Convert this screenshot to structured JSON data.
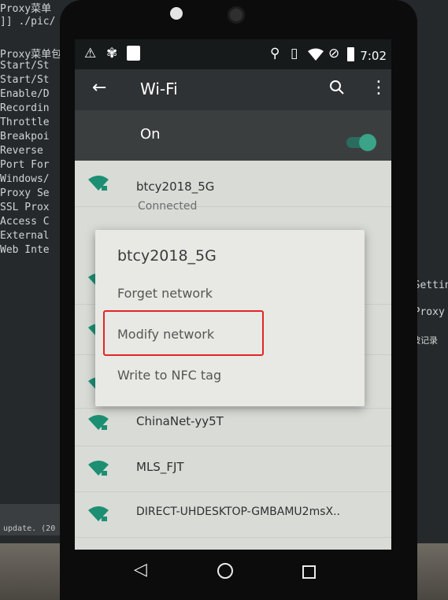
{
  "statusbar": {
    "time": "7:02",
    "icons": [
      "warning-icon",
      "app-icon",
      "image-icon",
      "location-icon",
      "vibrate-icon",
      "wifi-icon",
      "no-sim-icon",
      "battery-icon"
    ]
  },
  "appbar": {
    "title": "Wi-Fi"
  },
  "wifi_toggle": {
    "label": "On",
    "state": "on"
  },
  "networks": [
    {
      "ssid": "btcy2018_5G",
      "status": "Connected",
      "locked": true
    },
    {
      "ssid": "ChinaNet-yy5T",
      "locked": true
    },
    {
      "ssid": "MLS_FJT",
      "locked": true
    },
    {
      "ssid": "DIRECT-UHDESKTOP-GMBAMU2msX..",
      "locked": true
    }
  ],
  "dialog": {
    "title": "btcy2018_5G",
    "items": [
      "Forget network",
      "Modify network",
      "Write to NFC tag"
    ],
    "highlighted_item": "Modify network"
  },
  "background_terminal": {
    "lines": [
      "Proxy菜单",
      "]] ./pic/",
      "Proxy菜单包",
      "Start/St",
      "Start/St",
      "Enable/D",
      "Recordin",
      "Throttle",
      "Breakpoi",
      "Reverse",
      "Port For",
      "Windows/",
      "Proxy Se",
      "SSL Prox",
      "Access C",
      "External",
      "Web Inte"
    ],
    "right_text": [
      "y Settin",
      "S Proxy",
      "不被记录"
    ],
    "bottom_text": "update. (20"
  },
  "colors": {
    "accent": "#3aa388",
    "highlight": "#e32426",
    "appbar": "#2f3234"
  }
}
